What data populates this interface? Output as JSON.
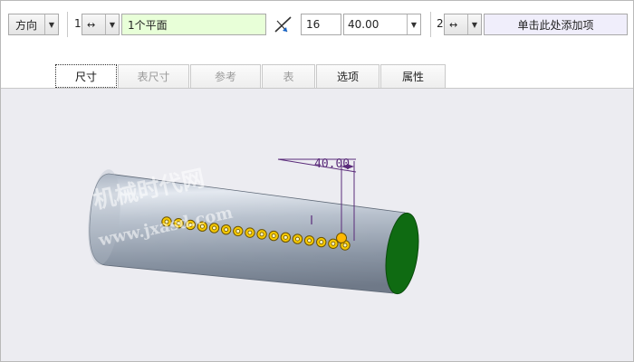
{
  "toolbar": {
    "direction_label": "方向",
    "section1_number": "1",
    "section1_arrow_icon": "↔",
    "reference_field": "1个平面",
    "count_value": "16",
    "spacing_value": "40.00",
    "section2_number": "2",
    "section2_arrow_icon": "↔",
    "add_item_label": "单击此处添加项"
  },
  "tabs": [
    {
      "label": "尺寸",
      "state": "active"
    },
    {
      "label": "表尺寸",
      "state": "disabled"
    },
    {
      "label": "参考",
      "state": "disabled"
    },
    {
      "label": "表",
      "state": "disabled"
    },
    {
      "label": "选项",
      "state": "enabled"
    },
    {
      "label": "属性",
      "state": "enabled"
    }
  ],
  "viewport": {
    "dimension_text": "40.00",
    "pattern_hole_count": 16,
    "watermark_line1": "机械时代网",
    "watermark_line2": "www.jxasd.com"
  },
  "colors": {
    "reference_field_bg": "#e8ffd8",
    "add_item_bg": "#f0eefb",
    "viewport_bg": "#ececf1",
    "cylinder_end": "#0f6b12",
    "hole_fill": "#f5c800",
    "dimension_color": "#5a2b7a"
  }
}
